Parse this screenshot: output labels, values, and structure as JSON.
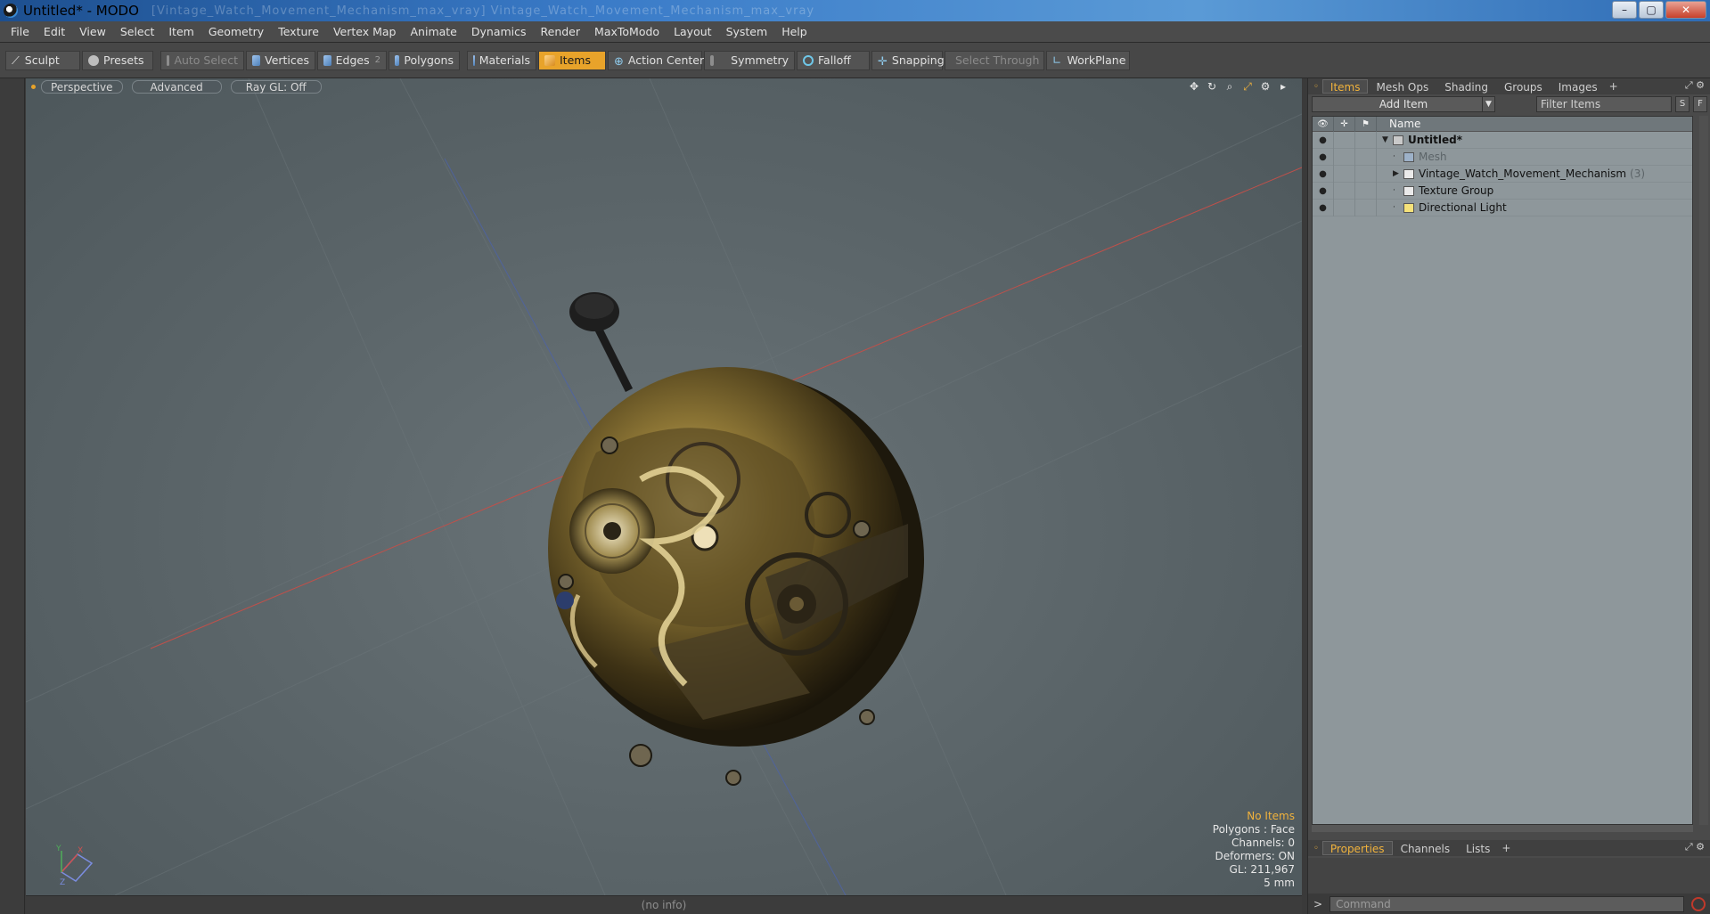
{
  "window": {
    "title": "Untitled* - MODO",
    "blurred_path": "[Vintage_Watch_Movement_Mechanism_max_vray] Vintage_Watch_Movement_Mechanism_max_vray",
    "controls": [
      "–",
      "▢",
      "✕"
    ]
  },
  "menubar": {
    "items": [
      "File",
      "Edit",
      "View",
      "Select",
      "Item",
      "Geometry",
      "Texture",
      "Vertex Map",
      "Animate",
      "Dynamics",
      "Render",
      "MaxToModo",
      "Layout",
      "System",
      "Help"
    ]
  },
  "toolbar": {
    "sculpt": "Sculpt",
    "presets": "Presets",
    "auto_select": "Auto Select",
    "vertices": "Vertices",
    "edges": "Edges",
    "edges_count": "2",
    "polygons": "Polygons",
    "materials": "Materials",
    "items": "Items",
    "action_center": "Action Center",
    "symmetry": "Symmetry",
    "falloff": "Falloff",
    "snapping": "Snapping",
    "select_through": "Select Through",
    "workplane": "WorkPlane"
  },
  "viewport": {
    "tabs": [
      "Perspective",
      "Advanced",
      "Ray GL: Off"
    ],
    "icons": [
      "move-view-icon",
      "rotate-view-icon",
      "zoom-view-icon",
      "maximize-view-icon",
      "settings-icon",
      "more-arrow-icon"
    ],
    "info": {
      "no_items": "No Items",
      "polygons": "Polygons : Face",
      "channels": "Channels: 0",
      "deformers": "Deformers: ON",
      "gl": "GL: 211,967",
      "scale": "5 mm"
    },
    "status": "(no info)"
  },
  "items_panel": {
    "tabs": [
      "Items",
      "Mesh Ops",
      "Shading",
      "Groups",
      "Images"
    ],
    "add_item": "Add Item",
    "filter_placeholder": "Filter Items",
    "s_btn": "S",
    "f_btn": "F",
    "column_name": "Name",
    "rows": [
      {
        "name": "Untitled*",
        "count": ""
      },
      {
        "name": "Mesh",
        "count": ""
      },
      {
        "name": "Vintage_Watch_Movement_Mechanism",
        "count": "(3)"
      },
      {
        "name": "Texture Group",
        "count": ""
      },
      {
        "name": "Directional Light",
        "count": ""
      }
    ]
  },
  "properties_panel": {
    "tabs": [
      "Properties",
      "Channels",
      "Lists"
    ]
  },
  "command": {
    "prompt": ">",
    "placeholder": "Command"
  },
  "colors": {
    "accent": "#e8a32a",
    "viewport_bg": "#5b6569",
    "list_bg": "#8e979b"
  }
}
